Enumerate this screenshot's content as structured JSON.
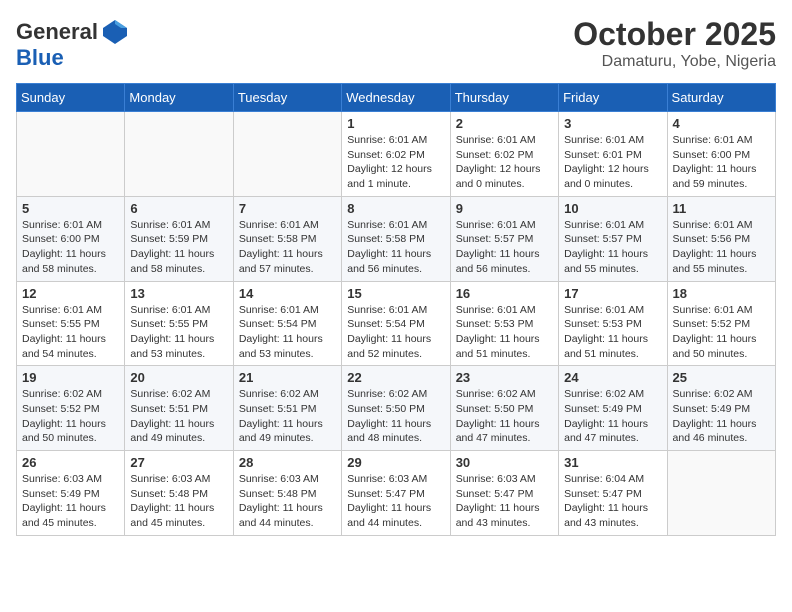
{
  "header": {
    "logo_general": "General",
    "logo_blue": "Blue",
    "month": "October 2025",
    "location": "Damaturu, Yobe, Nigeria"
  },
  "weekdays": [
    "Sunday",
    "Monday",
    "Tuesday",
    "Wednesday",
    "Thursday",
    "Friday",
    "Saturday"
  ],
  "weeks": [
    [
      {
        "day": "",
        "info": ""
      },
      {
        "day": "",
        "info": ""
      },
      {
        "day": "",
        "info": ""
      },
      {
        "day": "1",
        "info": "Sunrise: 6:01 AM\nSunset: 6:02 PM\nDaylight: 12 hours\nand 1 minute."
      },
      {
        "day": "2",
        "info": "Sunrise: 6:01 AM\nSunset: 6:02 PM\nDaylight: 12 hours\nand 0 minutes."
      },
      {
        "day": "3",
        "info": "Sunrise: 6:01 AM\nSunset: 6:01 PM\nDaylight: 12 hours\nand 0 minutes."
      },
      {
        "day": "4",
        "info": "Sunrise: 6:01 AM\nSunset: 6:00 PM\nDaylight: 11 hours\nand 59 minutes."
      }
    ],
    [
      {
        "day": "5",
        "info": "Sunrise: 6:01 AM\nSunset: 6:00 PM\nDaylight: 11 hours\nand 58 minutes."
      },
      {
        "day": "6",
        "info": "Sunrise: 6:01 AM\nSunset: 5:59 PM\nDaylight: 11 hours\nand 58 minutes."
      },
      {
        "day": "7",
        "info": "Sunrise: 6:01 AM\nSunset: 5:58 PM\nDaylight: 11 hours\nand 57 minutes."
      },
      {
        "day": "8",
        "info": "Sunrise: 6:01 AM\nSunset: 5:58 PM\nDaylight: 11 hours\nand 56 minutes."
      },
      {
        "day": "9",
        "info": "Sunrise: 6:01 AM\nSunset: 5:57 PM\nDaylight: 11 hours\nand 56 minutes."
      },
      {
        "day": "10",
        "info": "Sunrise: 6:01 AM\nSunset: 5:57 PM\nDaylight: 11 hours\nand 55 minutes."
      },
      {
        "day": "11",
        "info": "Sunrise: 6:01 AM\nSunset: 5:56 PM\nDaylight: 11 hours\nand 55 minutes."
      }
    ],
    [
      {
        "day": "12",
        "info": "Sunrise: 6:01 AM\nSunset: 5:55 PM\nDaylight: 11 hours\nand 54 minutes."
      },
      {
        "day": "13",
        "info": "Sunrise: 6:01 AM\nSunset: 5:55 PM\nDaylight: 11 hours\nand 53 minutes."
      },
      {
        "day": "14",
        "info": "Sunrise: 6:01 AM\nSunset: 5:54 PM\nDaylight: 11 hours\nand 53 minutes."
      },
      {
        "day": "15",
        "info": "Sunrise: 6:01 AM\nSunset: 5:54 PM\nDaylight: 11 hours\nand 52 minutes."
      },
      {
        "day": "16",
        "info": "Sunrise: 6:01 AM\nSunset: 5:53 PM\nDaylight: 11 hours\nand 51 minutes."
      },
      {
        "day": "17",
        "info": "Sunrise: 6:01 AM\nSunset: 5:53 PM\nDaylight: 11 hours\nand 51 minutes."
      },
      {
        "day": "18",
        "info": "Sunrise: 6:01 AM\nSunset: 5:52 PM\nDaylight: 11 hours\nand 50 minutes."
      }
    ],
    [
      {
        "day": "19",
        "info": "Sunrise: 6:02 AM\nSunset: 5:52 PM\nDaylight: 11 hours\nand 50 minutes."
      },
      {
        "day": "20",
        "info": "Sunrise: 6:02 AM\nSunset: 5:51 PM\nDaylight: 11 hours\nand 49 minutes."
      },
      {
        "day": "21",
        "info": "Sunrise: 6:02 AM\nSunset: 5:51 PM\nDaylight: 11 hours\nand 49 minutes."
      },
      {
        "day": "22",
        "info": "Sunrise: 6:02 AM\nSunset: 5:50 PM\nDaylight: 11 hours\nand 48 minutes."
      },
      {
        "day": "23",
        "info": "Sunrise: 6:02 AM\nSunset: 5:50 PM\nDaylight: 11 hours\nand 47 minutes."
      },
      {
        "day": "24",
        "info": "Sunrise: 6:02 AM\nSunset: 5:49 PM\nDaylight: 11 hours\nand 47 minutes."
      },
      {
        "day": "25",
        "info": "Sunrise: 6:02 AM\nSunset: 5:49 PM\nDaylight: 11 hours\nand 46 minutes."
      }
    ],
    [
      {
        "day": "26",
        "info": "Sunrise: 6:03 AM\nSunset: 5:49 PM\nDaylight: 11 hours\nand 45 minutes."
      },
      {
        "day": "27",
        "info": "Sunrise: 6:03 AM\nSunset: 5:48 PM\nDaylight: 11 hours\nand 45 minutes."
      },
      {
        "day": "28",
        "info": "Sunrise: 6:03 AM\nSunset: 5:48 PM\nDaylight: 11 hours\nand 44 minutes."
      },
      {
        "day": "29",
        "info": "Sunrise: 6:03 AM\nSunset: 5:47 PM\nDaylight: 11 hours\nand 44 minutes."
      },
      {
        "day": "30",
        "info": "Sunrise: 6:03 AM\nSunset: 5:47 PM\nDaylight: 11 hours\nand 43 minutes."
      },
      {
        "day": "31",
        "info": "Sunrise: 6:04 AM\nSunset: 5:47 PM\nDaylight: 11 hours\nand 43 minutes."
      },
      {
        "day": "",
        "info": ""
      }
    ]
  ]
}
